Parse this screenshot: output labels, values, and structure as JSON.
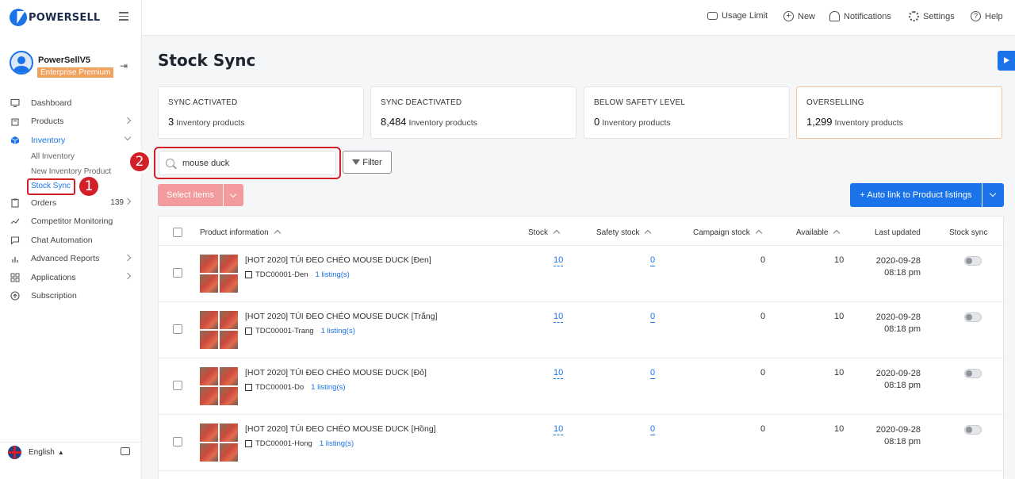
{
  "brand": {
    "name": "POWERSELL"
  },
  "user": {
    "name": "PowerSellV5",
    "plan": "Enterprise Premium"
  },
  "sidebar": {
    "items": [
      {
        "label": "Dashboard",
        "icon": "monitor-icon"
      },
      {
        "label": "Products",
        "icon": "bag-icon"
      },
      {
        "label": "Inventory",
        "icon": "cube-icon"
      },
      {
        "label": "Orders",
        "icon": "clipboard-icon",
        "badge": "139"
      },
      {
        "label": "Competitor Monitoring",
        "icon": "trend-icon"
      },
      {
        "label": "Chat Automation",
        "icon": "chat-icon"
      },
      {
        "label": "Advanced Reports",
        "icon": "bar-chart-icon"
      },
      {
        "label": "Applications",
        "icon": "grid-icon"
      },
      {
        "label": "Subscription",
        "icon": "arrow-up-circle-icon"
      }
    ],
    "inventory_sub": [
      "All Inventory",
      "New Inventory Product",
      "Stock Sync"
    ],
    "language": "English"
  },
  "annotations": {
    "step1": "1",
    "step2": "2"
  },
  "topbar": {
    "usage_limit": "Usage Limit",
    "new": "New",
    "notifications": "Notifications",
    "settings": "Settings",
    "help": "Help"
  },
  "page": {
    "title": "Stock Sync"
  },
  "stats": [
    {
      "label": "SYNC ACTIVATED",
      "value": "3",
      "unit": "Inventory products"
    },
    {
      "label": "SYNC DEACTIVATED",
      "value": "8,484",
      "unit": "Inventory products"
    },
    {
      "label": "BELOW SAFETY LEVEL",
      "value": "0",
      "unit": "Inventory products"
    },
    {
      "label": "OVERSELLING",
      "value": "1,299",
      "unit": "Inventory products"
    }
  ],
  "search": {
    "value": "mouse duck",
    "placeholder": ""
  },
  "toolbar": {
    "filter": "Filter",
    "select_items": "Select items",
    "auto_link": "+ Auto link to Product listings"
  },
  "table": {
    "headers": {
      "product": "Product information",
      "stock": "Stock",
      "safety": "Safety stock",
      "campaign": "Campaign stock",
      "available": "Available",
      "updated": "Last updated",
      "sync": "Stock sync"
    },
    "rows": [
      {
        "name": "[HOT 2020] TÚI ĐEO CHÉO MOUSE DUCK [Đen]",
        "sku": "TDC00001-Den",
        "listings": "1 listing(s)",
        "stock": "10",
        "safety": "0",
        "campaign": "0",
        "available": "10",
        "date": "2020-09-28",
        "time": "08:18 pm"
      },
      {
        "name": "[HOT 2020] TÚI ĐEO CHÉO MOUSE DUCK [Trắng]",
        "sku": "TDC00001-Trang",
        "listings": "1 listing(s)",
        "stock": "10",
        "safety": "0",
        "campaign": "0",
        "available": "10",
        "date": "2020-09-28",
        "time": "08:18 pm"
      },
      {
        "name": "[HOT 2020] TÚI ĐEO CHÉO MOUSE DUCK [Đỏ]",
        "sku": "TDC00001-Do",
        "listings": "1 listing(s)",
        "stock": "10",
        "safety": "0",
        "campaign": "0",
        "available": "10",
        "date": "2020-09-28",
        "time": "08:18 pm"
      },
      {
        "name": "[HOT 2020] TÚI ĐEO CHÉO MOUSE DUCK [Hồng]",
        "sku": "TDC00001-Hong",
        "listings": "1 listing(s)",
        "stock": "10",
        "safety": "0",
        "campaign": "0",
        "available": "10",
        "date": "2020-09-28",
        "time": "08:18 pm"
      }
    ]
  },
  "colors": {
    "accent": "#1a73e8",
    "annotation": "#d32028",
    "plan_badge": "#f0a15e"
  }
}
